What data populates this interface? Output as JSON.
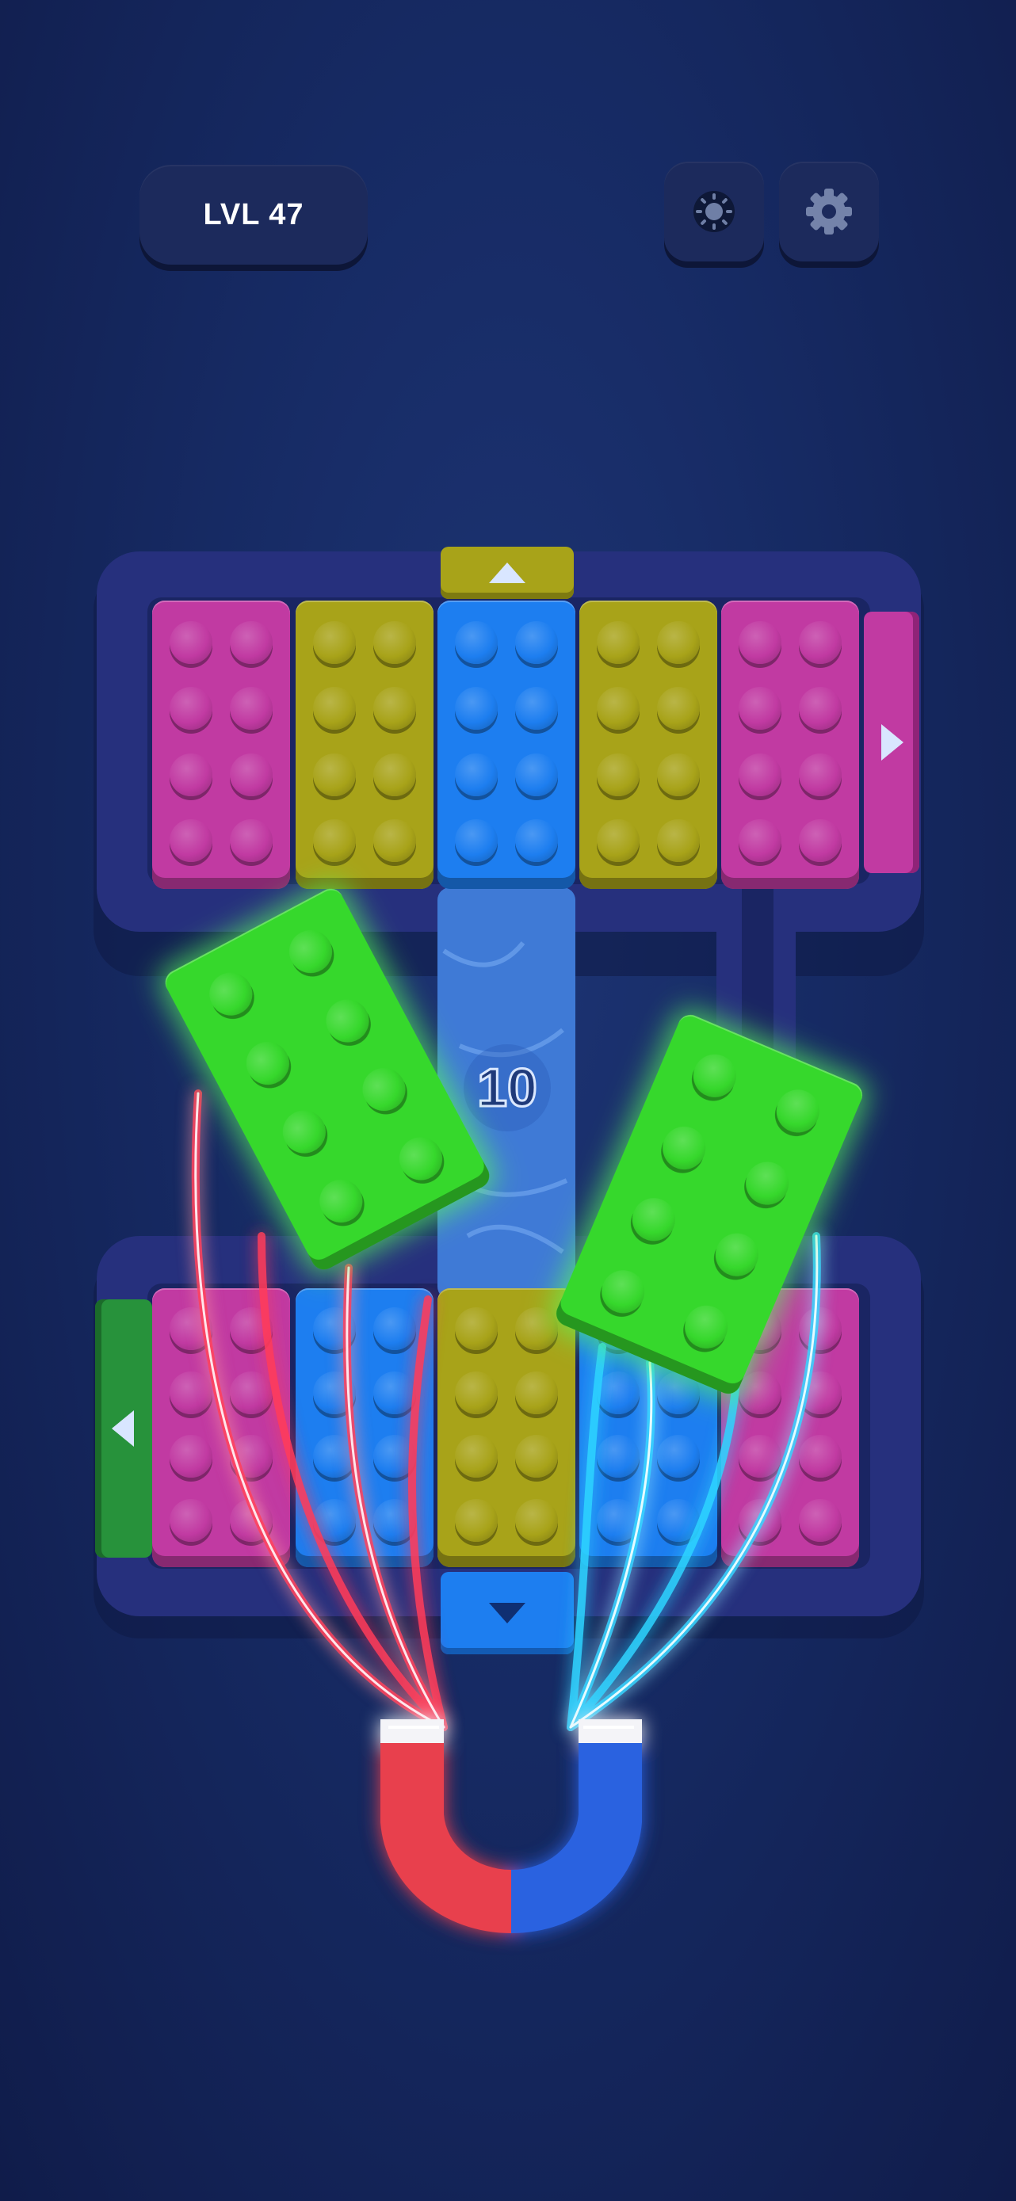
{
  "header": {
    "level_label": "LVL 47"
  },
  "buttons": {
    "theme_icon": "sun-icon",
    "settings_icon": "gear-icon"
  },
  "board": {
    "conveyor_count": "10",
    "top_row_colors": [
      "pink",
      "yellow",
      "blue",
      "yellow",
      "pink"
    ],
    "bottom_row_colors": [
      "pink",
      "blue",
      "yellow",
      "blue",
      "pink"
    ],
    "flying_bricks_color": "green",
    "gates": {
      "top": {
        "color": "yellow",
        "direction": "up"
      },
      "right": {
        "color": "pink",
        "direction": "right"
      },
      "left": {
        "color": "green",
        "direction": "left"
      },
      "bottom": {
        "color": "blue",
        "direction": "down"
      }
    }
  },
  "magnet": {
    "icon": "magnet-icon",
    "poles": [
      "red",
      "blue"
    ]
  },
  "colors": {
    "background": "#152659",
    "pink": "#c13aa2",
    "yellow": "#a8a319",
    "blue": "#1d7ef0",
    "green": "#36d82c",
    "red": "#f04a55",
    "board_frame": "#25307e"
  }
}
